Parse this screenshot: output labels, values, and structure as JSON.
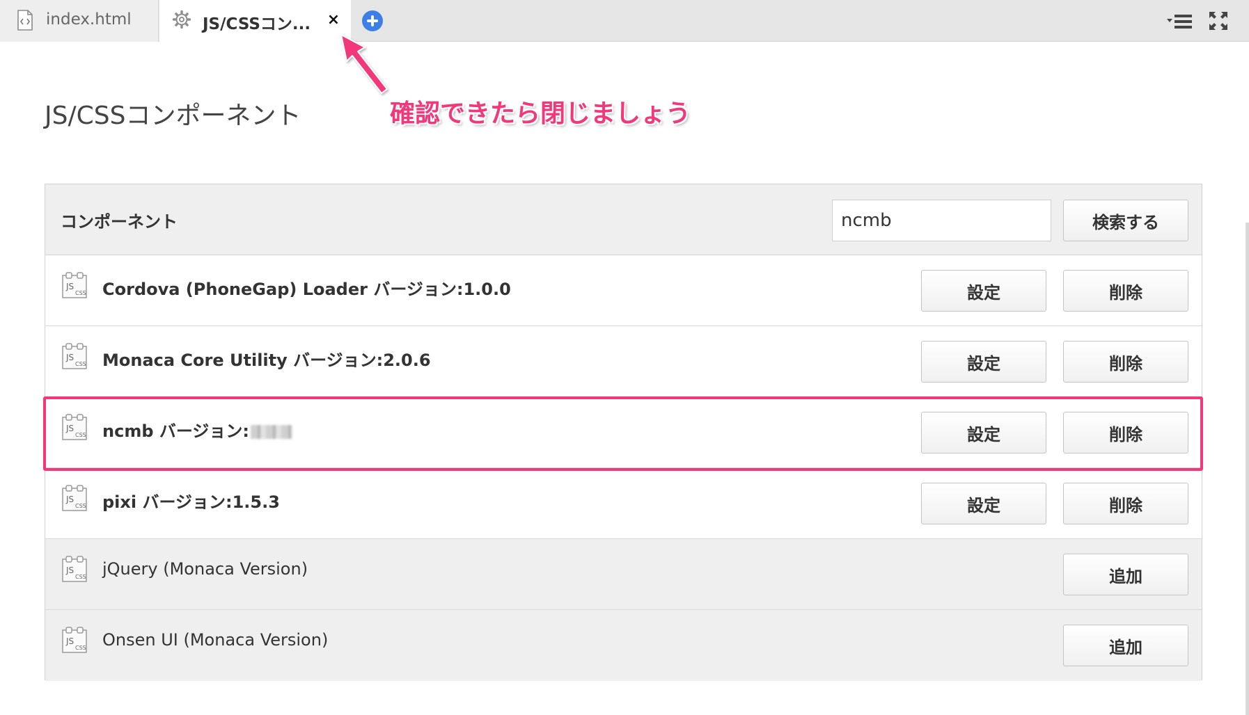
{
  "tabs": [
    {
      "label": "index.html",
      "icon": "html-file-icon",
      "active": false
    },
    {
      "label": "JS/CSSコン...",
      "icon": "gear-icon",
      "active": true,
      "close_symbol": "×"
    }
  ],
  "page_title": "JS/CSSコンポーネント",
  "annotation": "確認できたら閉じましょう",
  "panel": {
    "header_title": "コンポーネント",
    "search_value": "ncmb",
    "search_button": "検索する"
  },
  "installed": [
    {
      "name": "Cordova (PhoneGap) Loader バージョン:1.0.0",
      "settings_label": "設定",
      "delete_label": "削除"
    },
    {
      "name": "Monaca Core Utility バージョン:2.0.6",
      "settings_label": "設定",
      "delete_label": "削除"
    },
    {
      "name": "ncmb バージョン:",
      "settings_label": "設定",
      "delete_label": "削除"
    },
    {
      "name": "pixi バージョン:1.5.3",
      "settings_label": "設定",
      "delete_label": "削除"
    }
  ],
  "available": [
    {
      "name": "jQuery (Monaca Version)",
      "add_label": "追加"
    },
    {
      "name": "Onsen UI (Monaca Version)",
      "add_label": "追加"
    }
  ],
  "colors": {
    "annotation": "#f2387a",
    "add_tab_icon": "#3d7fe6",
    "panel_header_bg": "#efefef"
  }
}
